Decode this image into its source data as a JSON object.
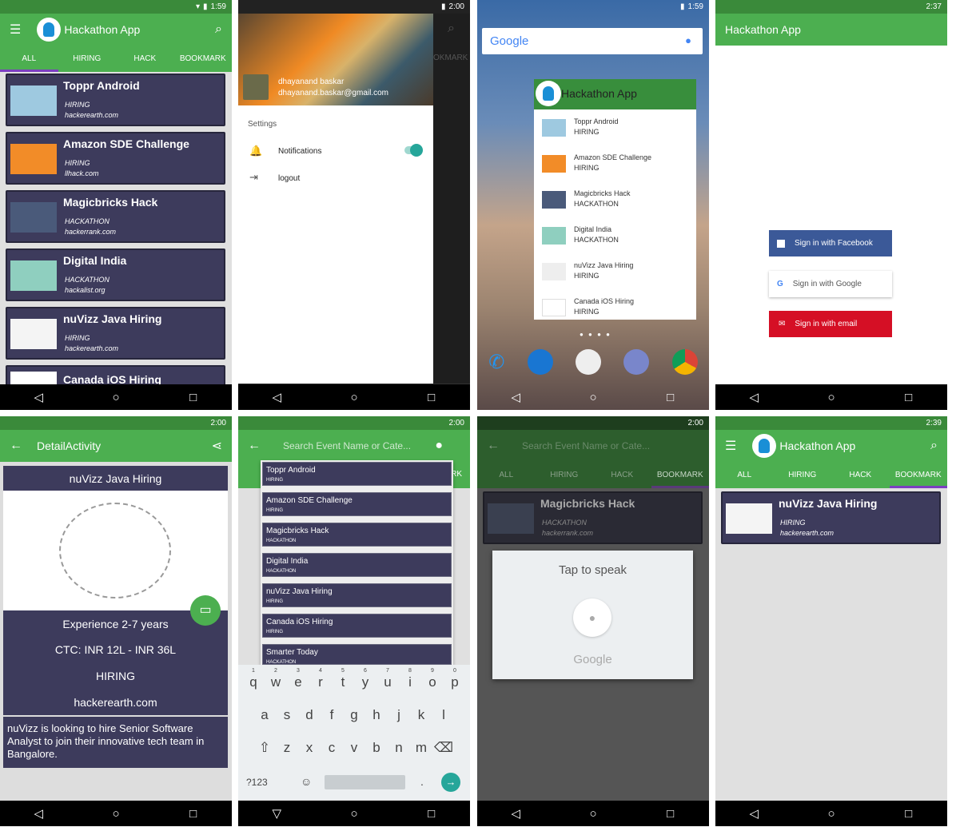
{
  "status": {
    "t1": "1:59",
    "t2": "2:00",
    "t3": "1:59",
    "t4": "2:37",
    "t5": "2:00",
    "t6": "2:00",
    "t7": "2:00",
    "t8": "2:39"
  },
  "app": {
    "title": "Hackathon App"
  },
  "tabs": [
    "ALL",
    "HIRING",
    "HACK",
    "BOOKMARK"
  ],
  "events": [
    {
      "title": "Toppr Android",
      "cat": "HIRING",
      "site": "hackerearth.com"
    },
    {
      "title": "Amazon SDE Challenge",
      "cat": "HIRING",
      "site": "llhack.com"
    },
    {
      "title": "Magicbricks Hack",
      "cat": "HACKATHON",
      "site": "hackerrank.com"
    },
    {
      "title": "Digital India",
      "cat": "HACKATHON",
      "site": "hackalist.org"
    },
    {
      "title": "nuVizz Java Hiring",
      "cat": "HIRING",
      "site": "hackerearth.com"
    },
    {
      "title": "Canada iOS Hiring"
    }
  ],
  "drawer": {
    "name": "dhayanand baskar",
    "email": "dhayanand.baskar@gmail.com",
    "settings": "Settings",
    "notifications": "Notifications",
    "logout": "logout",
    "bookmark_tab": "OKMARK"
  },
  "widget": {
    "google": "Google",
    "items": [
      {
        "title": "Toppr Android",
        "cat": "HIRING"
      },
      {
        "title": "Amazon SDE Challenge",
        "cat": "HIRING"
      },
      {
        "title": "Magicbricks Hack",
        "cat": "HACKATHON"
      },
      {
        "title": "Digital India",
        "cat": "HACKATHON"
      },
      {
        "title": "nuVizz Java Hiring",
        "cat": "HIRING"
      },
      {
        "title": "Canada iOS Hiring",
        "cat": "HIRING"
      }
    ]
  },
  "login": {
    "facebook": "Sign in with Facebook",
    "google": "Sign in with Google",
    "email": "Sign in with email"
  },
  "detail": {
    "title": "DetailActivity",
    "name": "nuVizz Java Hiring",
    "exp": "Experience 2-7 years",
    "ctc": "CTC: INR 12L - INR 36L",
    "cat": "HIRING",
    "site": "hackerearth.com",
    "desc": "nuVizz is looking to hire Senior Software Analyst to join their innovative tech team in Bangalore."
  },
  "search": {
    "placeholder": "Search Event Name or Cate...",
    "results": [
      {
        "title": "Toppr Android",
        "cat": "HIRING"
      },
      {
        "title": "Amazon SDE Challenge",
        "cat": "HIRING"
      },
      {
        "title": "Magicbricks Hack",
        "cat": "HACKATHON"
      },
      {
        "title": "Digital India",
        "cat": "HACKATHON"
      },
      {
        "title": "nuVizz Java Hiring",
        "cat": "HIRING"
      },
      {
        "title": "Canada iOS Hiring",
        "cat": "HIRING"
      },
      {
        "title": "Smarter Today",
        "cat": "HACKATHON"
      }
    ],
    "frag": "RK"
  },
  "keyboard": {
    "row1": [
      "q",
      "w",
      "e",
      "r",
      "t",
      "y",
      "u",
      "i",
      "o",
      "p"
    ],
    "nums": [
      "1",
      "2",
      "3",
      "4",
      "5",
      "6",
      "7",
      "8",
      "9",
      "0"
    ],
    "row2": [
      "a",
      "s",
      "d",
      "f",
      "g",
      "h",
      "j",
      "k",
      "l"
    ],
    "row3": [
      "z",
      "x",
      "c",
      "v",
      "b",
      "n",
      "m"
    ],
    "sym": "?123",
    "comma": ",",
    "dot": "."
  },
  "voice": {
    "tap": "Tap to speak",
    "brand": "Google",
    "card_title": "Magicbricks Hack",
    "card_cat": "HACKATHON",
    "card_site": "hackerrank.com"
  },
  "bookmark": {
    "title": "nuVizz Java Hiring",
    "cat": "HIRING",
    "site": "hackerearth.com"
  }
}
